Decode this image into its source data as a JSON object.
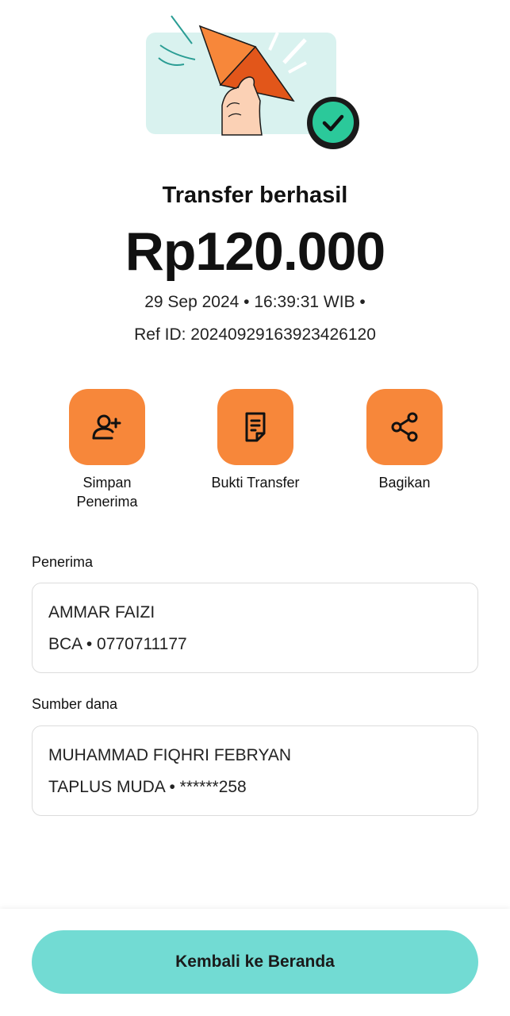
{
  "colors": {
    "accent_orange": "#f7873a",
    "primary_teal": "#72dbd3",
    "success_green": "#2bc99a"
  },
  "status": {
    "title": "Transfer berhasil",
    "amount": "Rp120.000",
    "datetime": "29 Sep 2024 • 16:39:31 WIB •",
    "ref": "Ref ID: 20240929163923426120"
  },
  "actions": [
    {
      "label": "Simpan\nPenerima",
      "icon": "add-person-icon"
    },
    {
      "label": "Bukti Transfer",
      "icon": "receipt-icon"
    },
    {
      "label": "Bagikan",
      "icon": "share-icon"
    }
  ],
  "recipient": {
    "label": "Penerima",
    "name": "AMMAR FAIZI",
    "account": "BCA • 0770711177"
  },
  "source": {
    "label": "Sumber dana",
    "name": "MUHAMMAD FIQHRI FEBRYAN",
    "account": "TAPLUS MUDA • ******258"
  },
  "footer": {
    "home_button": "Kembali ke Beranda"
  }
}
